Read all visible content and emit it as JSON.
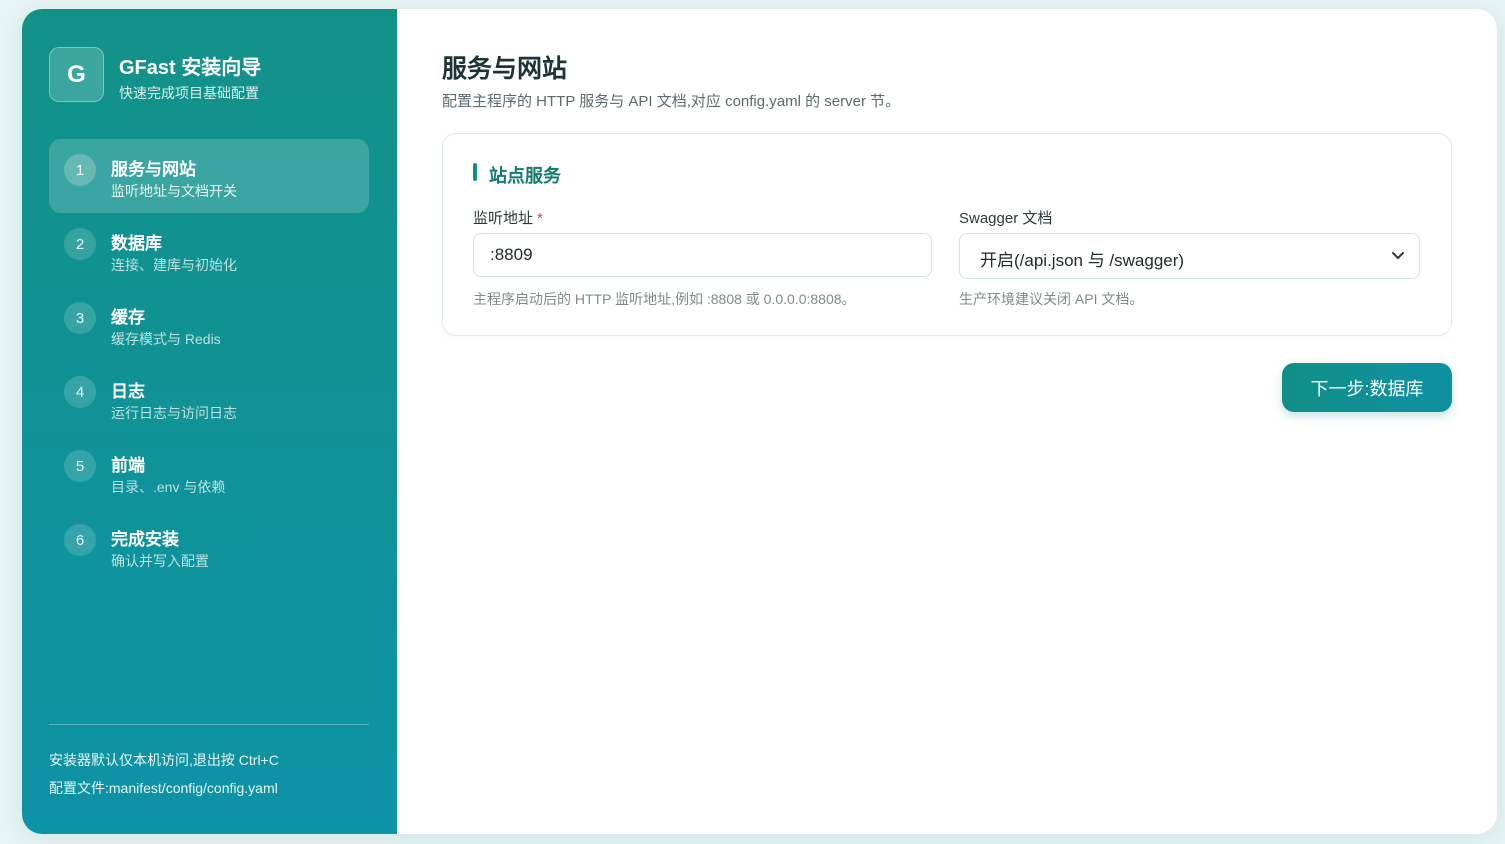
{
  "brand": {
    "logo_letter": "G",
    "title": "GFast 安装向导",
    "subtitle": "快速完成项目基础配置"
  },
  "steps": [
    {
      "num": "1",
      "title": "服务与网站",
      "desc": "监听地址与文档开关",
      "active": true
    },
    {
      "num": "2",
      "title": "数据库",
      "desc": "连接、建库与初始化"
    },
    {
      "num": "3",
      "title": "缓存",
      "desc": "缓存模式与 Redis"
    },
    {
      "num": "4",
      "title": "日志",
      "desc": "运行日志与访问日志"
    },
    {
      "num": "5",
      "title": "前端",
      "desc": "目录、.env 与依赖"
    },
    {
      "num": "6",
      "title": "完成安装",
      "desc": "确认并写入配置"
    }
  ],
  "footer": {
    "line1": "安装器默认仅本机访问,退出按 Ctrl+C",
    "line2": "配置文件:manifest/config/config.yaml"
  },
  "page": {
    "title": "服务与网站",
    "subtitle": "配置主程序的 HTTP 服务与 API 文档,对应 config.yaml 的 server 节。"
  },
  "card": {
    "title": "站点服务",
    "listen": {
      "label": "监听地址",
      "required_mark": "*",
      "value": ":8809",
      "hint": "主程序启动后的 HTTP 监听地址,例如 :8808 或 0.0.0.0:8808。"
    },
    "swagger": {
      "label": "Swagger 文档",
      "value": "开启(/api.json 与 /swagger)",
      "hint": "生产环境建议关闭 API 文档。"
    }
  },
  "next_button": "下一步:数据库",
  "colors": {
    "accent": "#139085",
    "sidebar_top": "#129287",
    "sidebar_bottom": "#0d93a6",
    "required": "#e03b3b"
  }
}
